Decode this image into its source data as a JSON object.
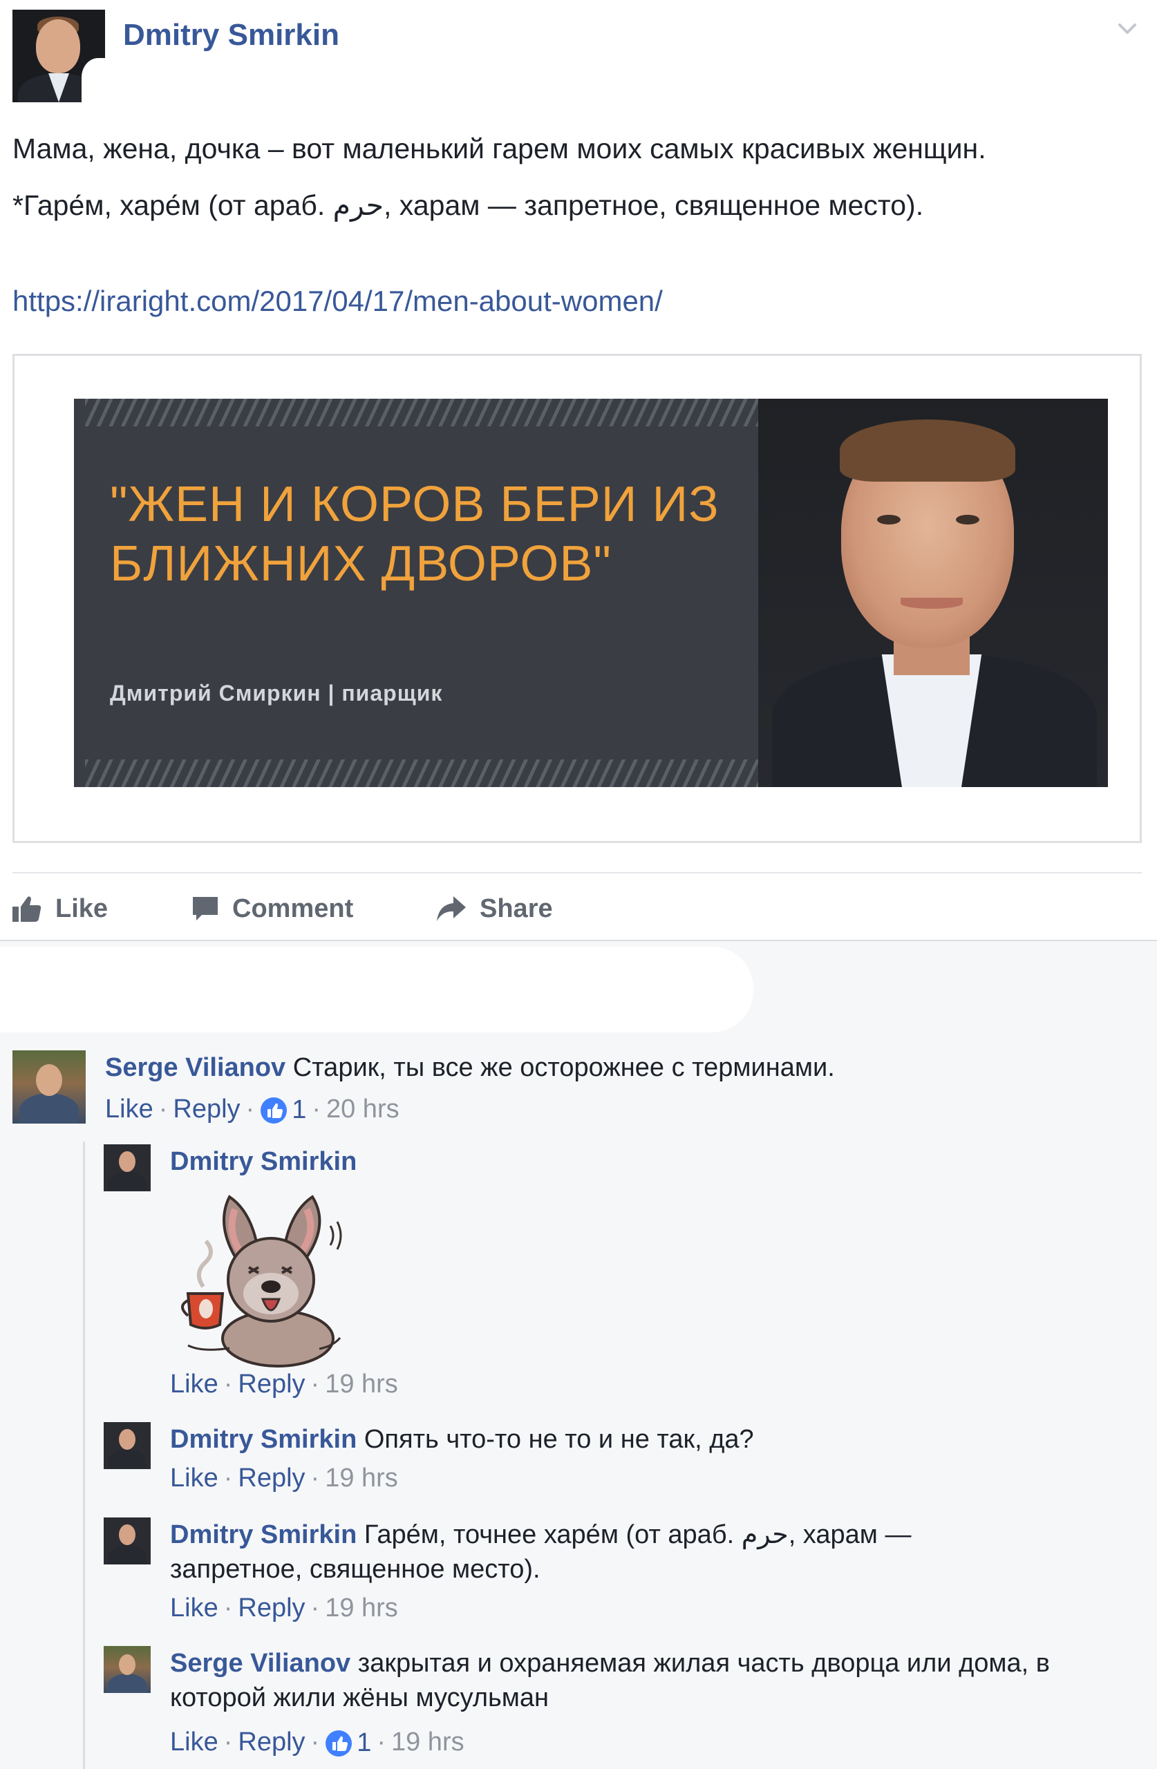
{
  "post": {
    "author": "Dmitry Smirkin",
    "text_line1": "Мама, жена, дочка – вот маленький гарем моих самых красивых женщин.",
    "text_line2": "*Гаре́м, харе́м (от араб. حرم, харам — запретное, священное место).",
    "link": "https://iraright.com/2017/04/17/men-about-women/"
  },
  "preview": {
    "quote": "\"ЖЕН И КОРОВ БЕРИ ИЗ БЛИЖНИХ ДВОРОВ\"",
    "caption": "Дмитрий Смиркин | пиарщик"
  },
  "actions": {
    "like": "Like",
    "comment": "Comment",
    "share": "Share"
  },
  "comments": [
    {
      "author": "Serge Vilianov",
      "text": "Старик, ты все же осторожнее с терминами.",
      "like": "Like",
      "reply": "Reply",
      "reactions": "1",
      "time": "20 hrs"
    },
    {
      "author": "Dmitry Smirkin",
      "text": "",
      "like": "Like",
      "reply": "Reply",
      "time": "19 hrs"
    },
    {
      "author": "Dmitry Smirkin",
      "text": "Опять что-то не то и не так, да?",
      "like": "Like",
      "reply": "Reply",
      "time": "19 hrs"
    },
    {
      "author": "Dmitry Smirkin",
      "text": "Гаре́м, точнее харе́м (от араб. حرم, харам — запретное, священное место).",
      "like": "Like",
      "reply": "Reply",
      "time": "19 hrs"
    },
    {
      "author": "Serge Vilianov",
      "text": "закрытая и охраняемая жилая часть дворца или дома, в которой жили жёны мусульман",
      "like": "Like",
      "reply": "Reply",
      "reactions": "1",
      "time": "19 hrs"
    }
  ],
  "icons": {
    "menu": "chevron-down-icon",
    "like": "thumbs-up-icon",
    "comment": "speech-bubble-icon",
    "share": "share-arrow-icon",
    "reaction": "like-reaction-icon",
    "sticker": "dog-with-coffee-sticker"
  },
  "colors": {
    "link_blue": "#385898",
    "meta_gray": "#90949c",
    "banner_bg": "#3a3d44",
    "banner_text": "#f0a23c",
    "like_badge": "#4080ff"
  }
}
